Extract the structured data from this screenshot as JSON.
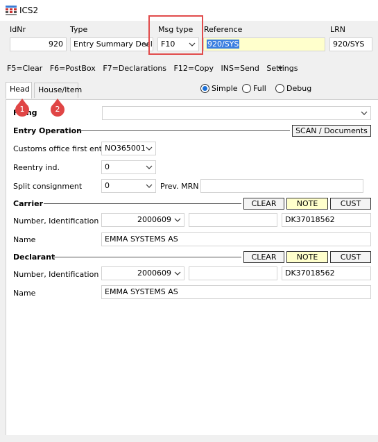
{
  "window": {
    "title": "ICS2"
  },
  "header": {
    "idnr": {
      "label": "IdNr",
      "value": "920"
    },
    "type": {
      "label": "Type",
      "value": "Entry Summary Decla"
    },
    "msg_type": {
      "label": "Msg type",
      "value": "F10"
    },
    "reference": {
      "label": "Reference",
      "value": "920/SYS"
    },
    "lrn": {
      "label": "LRN",
      "value": "920/SYS"
    }
  },
  "menu": {
    "items": [
      "F5=Clear",
      "F6=PostBox",
      "F7=Declarations",
      "F12=Copy",
      "INS=Send",
      "Settings"
    ]
  },
  "tabs": [
    {
      "label": "Head",
      "active": true
    },
    {
      "label": "House/Item",
      "active": false
    }
  ],
  "view_mode": {
    "options": [
      "Simple",
      "Full",
      "Debug"
    ],
    "selected": "Simple"
  },
  "annotations": [
    "1",
    "2"
  ],
  "form": {
    "filing_label": "Filing",
    "filing_value": "",
    "entry_operation": {
      "title": "Entry Operation",
      "scan_button": "SCAN / Documents",
      "customs_office_label": "Customs office first entry",
      "customs_office_value": "NO365001",
      "reentry_label": "Reentry ind.",
      "reentry_value": "0",
      "split_label": "Split consignment",
      "split_value": "0",
      "prev_mrn_label": "Prev. MRN",
      "prev_mrn_value": ""
    },
    "carrier": {
      "title": "Carrier",
      "clear": "CLEAR",
      "note": "NOTE",
      "cust": "CUST",
      "number_label": "Number, Identification",
      "number_value": "2000609",
      "ident_value": "",
      "eori_value": "DK37018562",
      "name_label": "Name",
      "name_value": "EMMA SYSTEMS AS"
    },
    "declarant": {
      "title": "Declarant",
      "clear": "CLEAR",
      "note": "NOTE",
      "cust": "CUST",
      "number_label": "Number, Identification",
      "number_value": "2000609",
      "ident_value": "",
      "eori_value": "DK37018562",
      "name_label": "Name",
      "name_value": "EMMA SYSTEMS AS"
    }
  },
  "colors": {
    "highlight_box": "#e14b4b",
    "badge": "#e04545",
    "note_button": "#ffffcc",
    "selection": "#3b7fe0"
  }
}
